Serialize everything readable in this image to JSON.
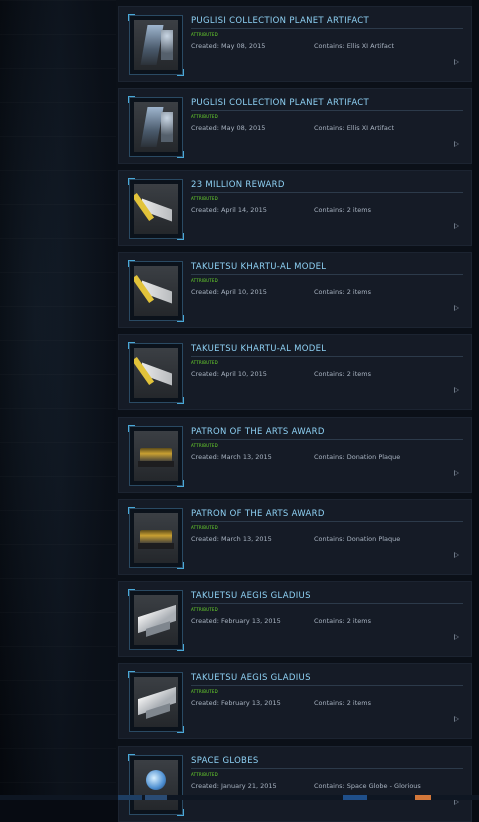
{
  "items": [
    {
      "title": "PUGLISI COLLECTION PLANET ARTIFACT",
      "status": "ATTRIBUTED",
      "created": "Created: May 08, 2015",
      "contains": "Contains: Ellis XI Artifact",
      "art": "art-pugl",
      "thumb_icon": "artifact-thumbnail"
    },
    {
      "title": "PUGLISI COLLECTION PLANET ARTIFACT",
      "status": "ATTRIBUTED",
      "created": "Created: May 08, 2015",
      "contains": "Contains: Ellis XI Artifact",
      "art": "art-pugl",
      "thumb_icon": "artifact-thumbnail"
    },
    {
      "title": "23 MILLION REWARD",
      "status": "ATTRIBUTED",
      "created": "Created: April 14, 2015",
      "contains": "Contains: 2 items",
      "art": "art-ship",
      "thumb_icon": "ship-model-thumbnail"
    },
    {
      "title": "TAKUETSU KHARTU-AL MODEL",
      "status": "ATTRIBUTED",
      "created": "Created: April 10, 2015",
      "contains": "Contains: 2 items",
      "art": "art-ship",
      "thumb_icon": "ship-model-thumbnail"
    },
    {
      "title": "TAKUETSU KHARTU-AL MODEL",
      "status": "ATTRIBUTED",
      "created": "Created: April 10, 2015",
      "contains": "Contains: 2 items",
      "art": "art-ship",
      "thumb_icon": "ship-model-thumbnail"
    },
    {
      "title": "PATRON OF THE ARTS AWARD",
      "status": "ATTRIBUTED",
      "created": "Created: March 13, 2015",
      "contains": "Contains: Donation Plaque",
      "art": "art-plaque",
      "thumb_icon": "plaque-thumbnail"
    },
    {
      "title": "PATRON OF THE ARTS AWARD",
      "status": "ATTRIBUTED",
      "created": "Created: March 13, 2015",
      "contains": "Contains: Donation Plaque",
      "art": "art-plaque",
      "thumb_icon": "plaque-thumbnail"
    },
    {
      "title": "TAKUETSU AEGIS GLADIUS",
      "status": "ATTRIBUTED",
      "created": "Created: February 13, 2015",
      "contains": "Contains: 2 items",
      "art": "art-glad",
      "thumb_icon": "ship-model-thumbnail"
    },
    {
      "title": "TAKUETSU AEGIS GLADIUS",
      "status": "ATTRIBUTED",
      "created": "Created: February 13, 2015",
      "contains": "Contains: 2 items",
      "art": "art-glad",
      "thumb_icon": "ship-model-thumbnail"
    },
    {
      "title": "SPACE GLOBES",
      "status": "ATTRIBUTED",
      "created": "Created: January 21, 2015",
      "contains": "Contains: Space Globe - Glorious",
      "art": "art-globe",
      "thumb_icon": "globe-thumbnail"
    }
  ],
  "colors": {
    "title": "#8fd2f5",
    "status": "#6ddc2d",
    "meta": "#a9b4c2",
    "card": "#151b26",
    "accent": "#4aa9d8"
  },
  "icons": {
    "expand": "play-arrow-icon"
  }
}
